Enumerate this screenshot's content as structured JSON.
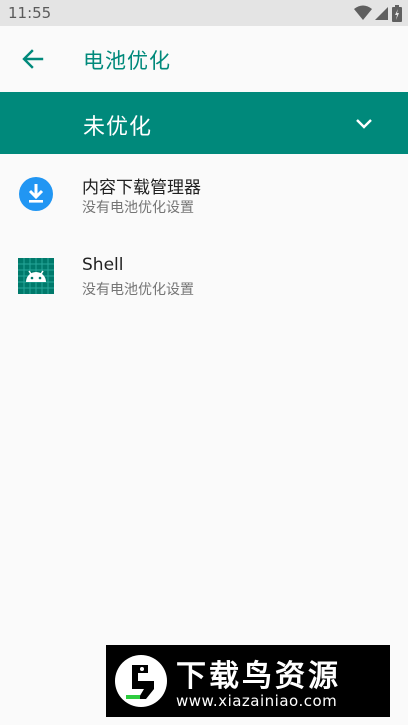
{
  "status_bar": {
    "time": "11:55",
    "icons": [
      "wifi-icon",
      "signal-icon",
      "battery-icon"
    ]
  },
  "app_bar": {
    "back_icon": "arrow-left-icon",
    "title": "电池优化"
  },
  "filter": {
    "selected": "未优化",
    "dropdown_icon": "chevron-down-icon"
  },
  "apps": [
    {
      "name": "内容下载管理器",
      "status": "没有电池优化设置",
      "icon": "download-icon"
    },
    {
      "name": "Shell",
      "status": "没有电池优化设置",
      "icon": "android-icon"
    }
  ],
  "watermark": {
    "title": "下载鸟资源",
    "url": "www.xiazainiao.com"
  },
  "colors": {
    "accent": "#00897b",
    "background": "#fafafa",
    "status_bar": "#e4e4e4",
    "download_blue": "#2196f3"
  }
}
